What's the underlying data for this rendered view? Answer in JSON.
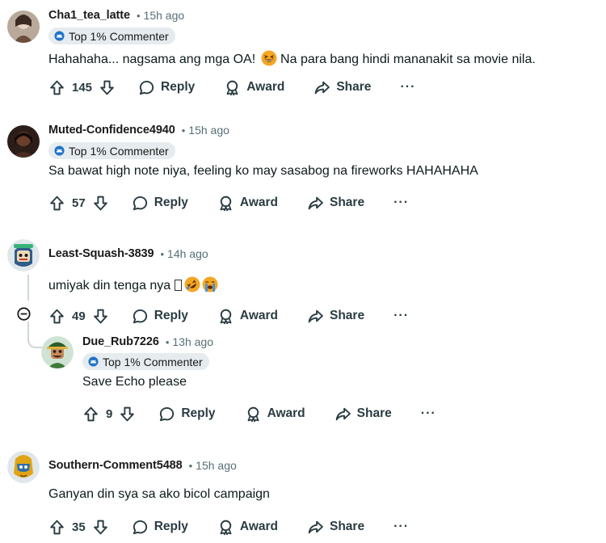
{
  "labels": {
    "reply": "Reply",
    "award": "Award",
    "share": "Share",
    "more": "···",
    "dot": "•"
  },
  "comments": [
    {
      "author": "Cha1_tea_latte",
      "time": "15h ago",
      "flair": "Top 1% Commenter",
      "text_before_emoji": "Hahahaha... nagsama ang mga OA! ",
      "emoji": "grinning-squint-face",
      "text_after_emoji": " Na para bang hindi mananakit sa movie nila.",
      "votes": "145"
    },
    {
      "author": "Muted-Confidence4940",
      "time": "15h ago",
      "flair": "Top 1% Commenter",
      "text": "Sa bawat high note niya, feeling ko may sasabog na fireworks HAHAHAHA",
      "votes": "57"
    },
    {
      "author": "Least-Squash-3839",
      "time": "14h ago",
      "text": "umiyak din tenga nya ",
      "emoji": [
        "rolling-on-floor-laughing-face",
        "loudly-crying-face"
      ],
      "votes": "49"
    },
    {
      "author": "Due_Rub7226",
      "time": "13h ago",
      "flair": "Top 1% Commenter",
      "text": "Save Echo please",
      "votes": "9"
    },
    {
      "author": "Southern-Comment5488",
      "time": "15h ago",
      "text": "Ganyan din sya sa ako bicol campaign",
      "votes": "35"
    }
  ],
  "colors": {
    "flair_bg": "#e5ebee",
    "meta_gray": "#576f76",
    "action_gray": "#2a3c42",
    "thread_line": "#d0d7da"
  }
}
